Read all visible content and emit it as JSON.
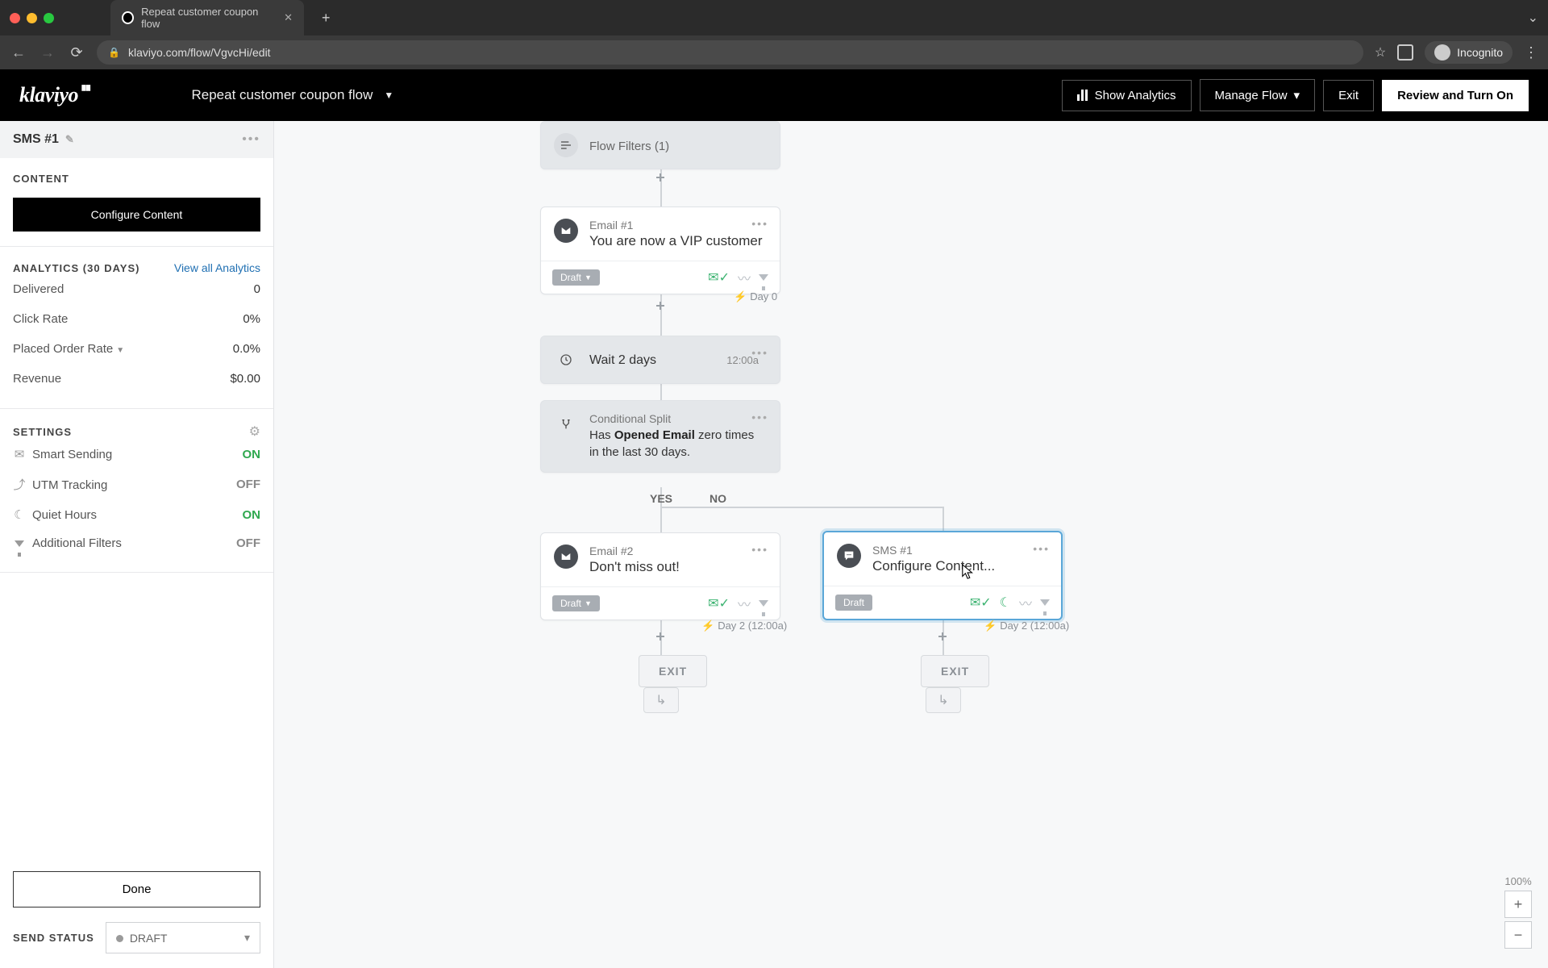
{
  "browser": {
    "tab_title": "Repeat customer coupon flow",
    "url": "klaviyo.com/flow/VgvcHi/edit",
    "incognito_label": "Incognito"
  },
  "header": {
    "logo_text": "klaviyo",
    "flow_name": "Repeat customer coupon flow",
    "show_analytics": "Show Analytics",
    "manage_flow": "Manage Flow",
    "exit": "Exit",
    "review": "Review and Turn On"
  },
  "sidebar": {
    "title": "SMS #1",
    "content_label": "CONTENT",
    "configure_btn": "Configure Content",
    "analytics_label": "ANALYTICS (30 DAYS)",
    "view_all": "View all Analytics",
    "metrics": {
      "delivered_label": "Delivered",
      "delivered_val": "0",
      "click_label": "Click Rate",
      "click_val": "0%",
      "placed_label": "Placed Order Rate",
      "placed_val": "0.0%",
      "revenue_label": "Revenue",
      "revenue_val": "$0.00"
    },
    "settings_label": "SETTINGS",
    "settings": {
      "smart_sending": {
        "label": "Smart Sending",
        "value": "ON"
      },
      "utm": {
        "label": "UTM Tracking",
        "value": "OFF"
      },
      "quiet": {
        "label": "Quiet Hours",
        "value": "ON"
      },
      "filters": {
        "label": "Additional Filters",
        "value": "OFF"
      }
    },
    "done": "Done",
    "send_status_label": "SEND STATUS",
    "send_status_value": "DRAFT"
  },
  "canvas": {
    "flow_filters": "Flow Filters (1)",
    "email1": {
      "title": "Email #1",
      "subject": "You are now a VIP customer",
      "status": "Draft",
      "day": "Day 0"
    },
    "wait": {
      "label": "Wait 2 days",
      "time": "12:00a"
    },
    "split": {
      "title": "Conditional Split",
      "line_pre": "Has ",
      "line_bold": "Opened Email",
      "line_post": " zero times in the last 30 days.",
      "yes": "YES",
      "no": "NO"
    },
    "email2": {
      "title": "Email #2",
      "subject": "Don't miss out!",
      "status": "Draft",
      "day": "Day 2 (12:00a)"
    },
    "sms1": {
      "title": "SMS #1",
      "subject": "Configure Content...",
      "status": "Draft",
      "day": "Day 2 (12:00a)"
    },
    "exit": "EXIT",
    "zoom": "100%"
  }
}
